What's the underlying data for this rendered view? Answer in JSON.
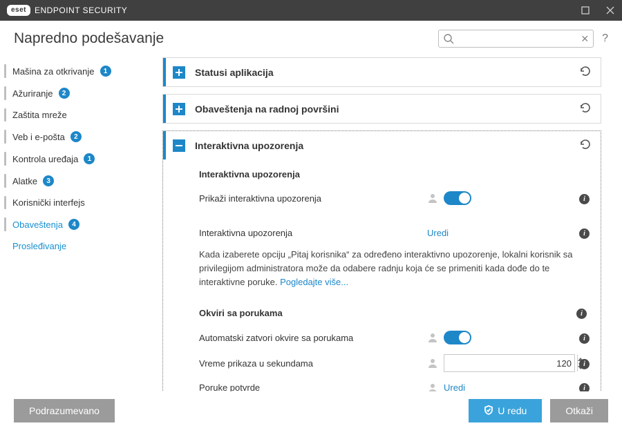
{
  "window": {
    "brand_badge": "eset",
    "product": "ENDPOINT SECURITY"
  },
  "page": {
    "title": "Napredno podešavanje"
  },
  "search": {
    "placeholder": "",
    "value": ""
  },
  "sidebar": {
    "items": [
      {
        "label": "Mašina za otkrivanje",
        "badge": "1"
      },
      {
        "label": "Ažuriranje",
        "badge": "2"
      },
      {
        "label": "Zaštita mreže",
        "badge": ""
      },
      {
        "label": "Veb i e-pošta",
        "badge": "2"
      },
      {
        "label": "Kontrola uređaja",
        "badge": "1"
      },
      {
        "label": "Alatke",
        "badge": "3"
      },
      {
        "label": "Korisnički interfejs",
        "badge": ""
      },
      {
        "label": "Obaveštenja",
        "badge": "4"
      },
      {
        "label": "Prosleđivanje",
        "badge": ""
      }
    ]
  },
  "sections": {
    "status_apps": {
      "title": "Statusi aplikacija"
    },
    "desktop_notifs": {
      "title": "Obaveštenja na radnoj površini"
    },
    "interactive": {
      "title": "Interaktivna upozorenja",
      "sub1_heading": "Interaktivna upozorenja",
      "show_interactive_label": "Prikaži interaktivna upozorenja",
      "edit_label": "Interaktivna upozorenja",
      "edit_link": "Uredi",
      "desc_before": "Kada izaberete opciju „Pitaj korisnika“ za određeno interaktivno upozorenje, lokalni korisnik sa privilegijom administratora može da odabere radnju koja će se primeniti kada dođe do te interaktivne poruke. ",
      "desc_link": "Pogledajte više...",
      "sub2_heading": "Okviri sa porukama",
      "autoclose_label": "Automatski zatvori okvire sa porukama",
      "display_time_label": "Vreme prikaza u sekundama",
      "display_time_value": "120",
      "confirm_msgs_label": "Poruke potvrde",
      "confirm_msgs_link": "Uredi"
    }
  },
  "footer": {
    "default": "Podrazumevano",
    "ok": "U redu",
    "cancel": "Otkaži"
  }
}
